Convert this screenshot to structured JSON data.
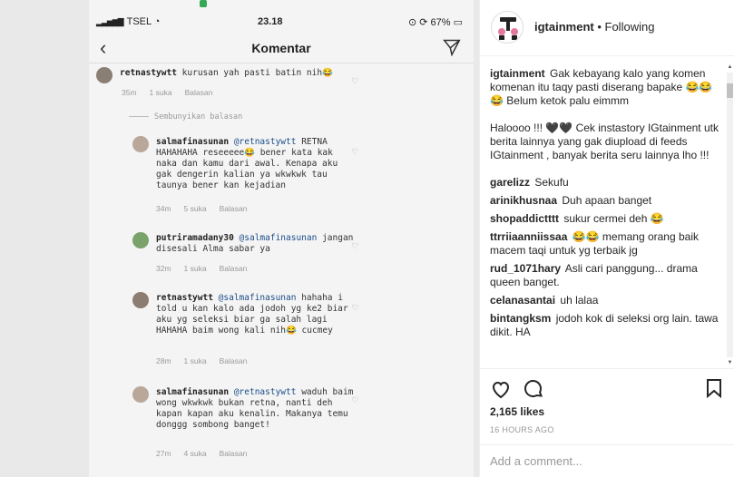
{
  "phone": {
    "carrier": "TSEL",
    "time": "23.18",
    "battery": "67%",
    "title": "Komentar",
    "hide_replies": "Sembunyikan balasan",
    "comments": [
      {
        "user": "retnastywtt",
        "mention": "",
        "text": "kurusan yah pasti batin nih😂",
        "time": "35m",
        "likes": "1 suka",
        "reply": "Balasan"
      },
      {
        "user": "salmafinasunan",
        "mention": "@retnastywtt",
        "text": "RETNA HAHAHAHA reseeeee😂 bener kata kak naka dan kamu dari awal. Kenapa aku gak dengerin kalian ya wkwkwk tau taunya bener kan kejadian",
        "time": "34m",
        "likes": "5 suka",
        "reply": "Balasan"
      },
      {
        "user": "putriramadany30",
        "mention": "@salmafinasunan",
        "text": "jangan disesali Alma sabar ya",
        "time": "32m",
        "likes": "1 suka",
        "reply": "Balasan"
      },
      {
        "user": "retnastywtt",
        "mention": "@salmafinasunan",
        "text": "hahaha i told u kan kalo ada jodoh yg ke2 biar aku yg seleksi biar ga salah lagi HAHAHA baim wong kali nih😂 cucmey",
        "time": "28m",
        "likes": "1 suka",
        "reply": "Balasan"
      },
      {
        "user": "salmafinasunan",
        "mention": "@retnastywtt",
        "text": "waduh baim wong wkwkwk bukan retna, nanti deh kapan kapan aku kenalin. Makanya temu donggg sombong banget!",
        "time": "27m",
        "likes": "4 suka",
        "reply": "Balasan"
      }
    ]
  },
  "post": {
    "username": "igtainment",
    "separator": " • ",
    "follow_status": "Following",
    "caption": {
      "user": "igtainment",
      "p1": "Gak kebayang kalo yang komen komenan itu taqy pasti diserang bapake 😂😂😂 Belum ketok palu eimmm",
      "p2": "Haloooo !!! 🖤🖤 Cek instastory IGtainment utk berita lainnya yang gak diupload di feeds IGtainment , banyak berita seru lainnya lho !!!"
    },
    "comments": [
      {
        "user": "garelizz",
        "text": "Sekufu"
      },
      {
        "user": "arinikhusnaa",
        "text": "Duh apaan banget"
      },
      {
        "user": "shopaddictttt",
        "text": "sukur cermei deh 😂"
      },
      {
        "user": "ttrriiaanniissaa",
        "text": "😂😂 memang orang baik macem taqi untuk yg terbaik jg"
      },
      {
        "user": "rud_1071hary",
        "text": "Asli cari panggung... drama queen banget."
      },
      {
        "user": "celanasantai",
        "text": "uh lalaa"
      },
      {
        "user": "bintangksm",
        "text": "jodoh kok di seleksi org lain. tawa dikit. HA"
      }
    ],
    "likes": "2,165 likes",
    "time_ago": "16 HOURS AGO",
    "add_comment_placeholder": "Add a comment..."
  },
  "icons": {
    "like": "heart-outline-icon",
    "comment": "speech-bubble-icon",
    "save": "bookmark-icon",
    "send": "paper-plane-icon",
    "back": "chevron-left-icon"
  }
}
